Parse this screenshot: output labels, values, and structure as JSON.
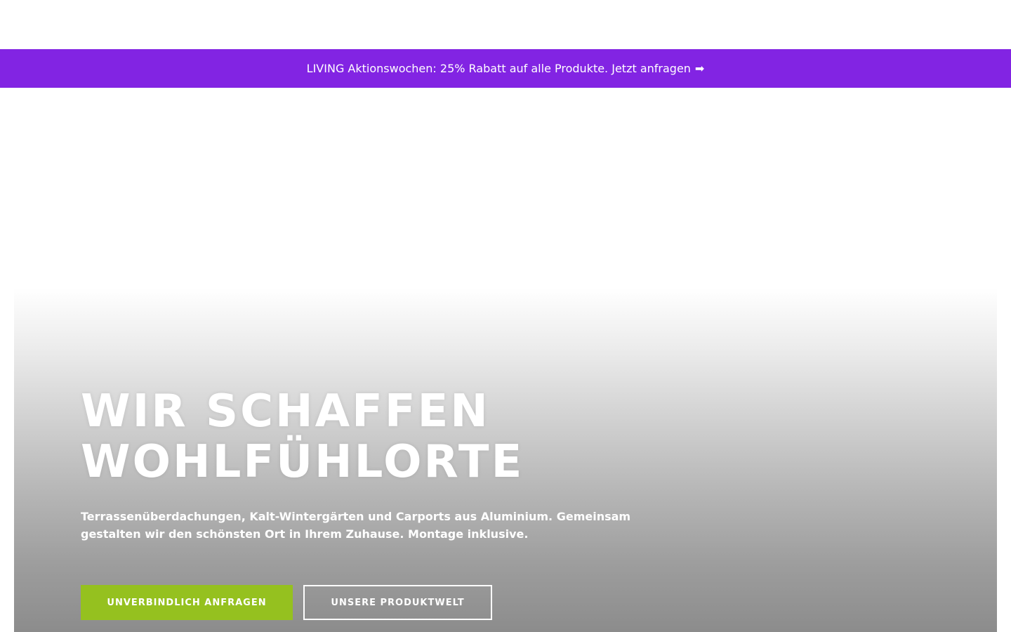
{
  "promo": {
    "text": "LIVING Aktionswochen: 25% Rabatt auf alle Produkte. Jetzt anfragen",
    "arrow": "➡"
  },
  "hero": {
    "title_line1": "WIR SCHAFFEN",
    "title_line2": "WOHLFÜHLORTE",
    "subtitle": "Terrassenüberdachungen, Kalt-Wintergärten und Carports aus Aluminium. Gemeinsam gestalten wir den schönsten Ort in Ihrem Zuhause. Montage inklusive.",
    "cta_primary": "UNVERBINDLICH ANFRAGEN",
    "cta_secondary": "UNSERE PRODUKTWELT"
  },
  "colors": {
    "promo_bg": "#8224e3",
    "cta_primary_bg": "#95c11f"
  }
}
